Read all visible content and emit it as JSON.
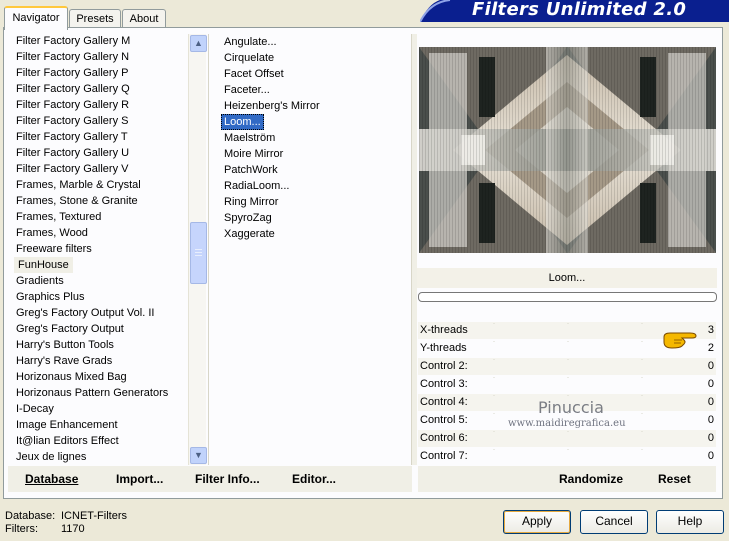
{
  "tabs": [
    {
      "label": "Navigator"
    },
    {
      "label": "Presets"
    },
    {
      "label": "About"
    }
  ],
  "banner": {
    "title": "Filters Unlimited 2.0"
  },
  "categories": {
    "items": [
      "Filter Factory Gallery M",
      "Filter Factory Gallery N",
      "Filter Factory Gallery P",
      "Filter Factory Gallery Q",
      "Filter Factory Gallery R",
      "Filter Factory Gallery S",
      "Filter Factory Gallery T",
      "Filter Factory Gallery U",
      "Filter Factory Gallery V",
      "Frames, Marble & Crystal",
      "Frames, Stone & Granite",
      "Frames, Textured",
      "Frames, Wood",
      "Freeware filters",
      "FunHouse",
      "Gradients",
      "Graphics Plus",
      "Greg's Factory Output Vol. II",
      "Greg's Factory Output",
      "Harry's Button Tools",
      "Harry's Rave Grads",
      "Horizonaus Mixed Bag",
      "Horizonaus Pattern Generators",
      "I-Decay",
      "Image Enhancement",
      "It@lian Editors Effect",
      "Jeux de lignes"
    ],
    "selected": "FunHouse"
  },
  "filters": {
    "items": [
      "Angulate...",
      "Cirquelate",
      "Facet Offset",
      "Faceter...",
      "Heizenberg's Mirror",
      "Loom...",
      "Maelström",
      "Moire Mirror",
      "PatchWork",
      "RadiaLoom...",
      "Ring Mirror",
      "SpyroZag",
      "Xaggerate"
    ],
    "selected": "Loom..."
  },
  "filter_name": "Loom...",
  "progress": 0,
  "controls": [
    {
      "label": "X-threads",
      "value": "3"
    },
    {
      "label": "Y-threads",
      "value": "2"
    },
    {
      "label": "Control 2:",
      "value": "0"
    },
    {
      "label": "Control 3:",
      "value": "0"
    },
    {
      "label": "Control 4:",
      "value": "0"
    },
    {
      "label": "Control 5:",
      "value": "0"
    },
    {
      "label": "Control 6:",
      "value": "0"
    },
    {
      "label": "Control 7:",
      "value": "0"
    }
  ],
  "watermark": {
    "name": "Pinuccia",
    "url": "www.maidiregrafica.eu"
  },
  "left_actions": {
    "database": "Database",
    "import": "Import...",
    "filter_info": "Filter Info...",
    "editor": "Editor..."
  },
  "right_actions": {
    "randomize": "Randomize",
    "reset": "Reset"
  },
  "status": {
    "database_label": "Database:",
    "database_value": "ICNET-Filters",
    "filters_label": "Filters:",
    "filters_value": "1170"
  },
  "buttons": {
    "apply": "Apply",
    "cancel": "Cancel",
    "help": "Help"
  },
  "icons": {
    "scroll_up": "scroll-up-icon",
    "scroll_down": "scroll-down-icon",
    "pointer_hand": "pointing-hand-icon"
  },
  "colors": {
    "selection": "#316ac5",
    "banner": "#0a1f8f",
    "face": "#ece9d8"
  }
}
